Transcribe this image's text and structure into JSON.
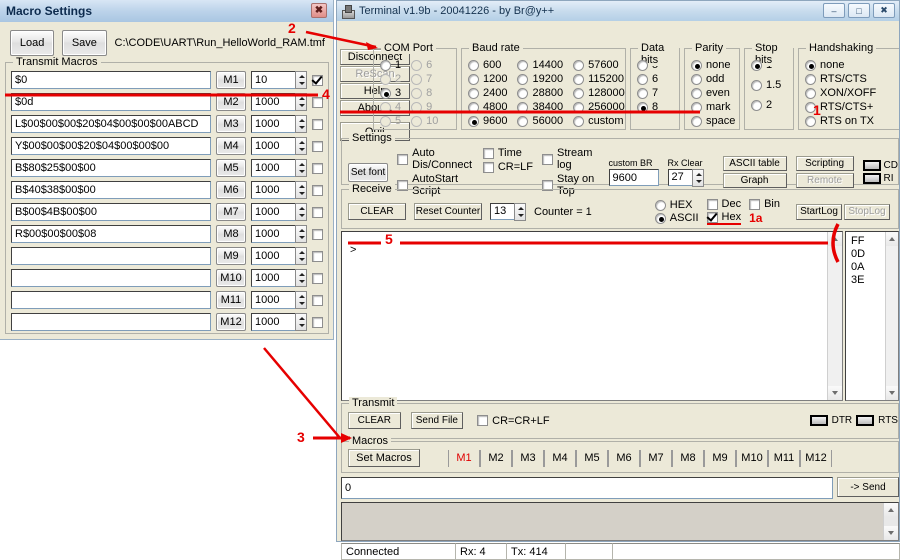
{
  "macro_window": {
    "title": "Macro Settings",
    "close_label": "✖",
    "load_label": "Load",
    "save_label": "Save",
    "file_path": "C:\\CODE\\UART\\Run_HelloWorld_RAM.tmf",
    "group_label": "Transmit Macros",
    "rows": [
      {
        "name": "M1",
        "text": "$0",
        "delay": "10",
        "checked": true
      },
      {
        "name": "M2",
        "text": "$0d",
        "delay": "1000",
        "checked": false
      },
      {
        "name": "M3",
        "text": "L$00$00$00$20$04$00$00$00ABCD",
        "delay": "1000",
        "checked": false
      },
      {
        "name": "M4",
        "text": "Y$00$00$00$20$04$00$00$00",
        "delay": "1000",
        "checked": false
      },
      {
        "name": "M5",
        "text": "B$80$25$00$00",
        "delay": "1000",
        "checked": false
      },
      {
        "name": "M6",
        "text": "B$40$38$00$00",
        "delay": "1000",
        "checked": false
      },
      {
        "name": "M7",
        "text": "B$00$4B$00$00",
        "delay": "1000",
        "checked": false
      },
      {
        "name": "M8",
        "text": "R$00$00$00$08",
        "delay": "1000",
        "checked": false
      },
      {
        "name": "M9",
        "text": "",
        "delay": "1000",
        "checked": false
      },
      {
        "name": "M10",
        "text": "",
        "delay": "1000",
        "checked": false
      },
      {
        "name": "M11",
        "text": "",
        "delay": "1000",
        "checked": false
      },
      {
        "name": "M12",
        "text": "",
        "delay": "1000",
        "checked": false
      }
    ]
  },
  "terminal": {
    "title": "Terminal v1.9b - 20041226 - by Br@y++",
    "titlebar_buttons": {
      "minimize": "–",
      "maximize": "□",
      "close": "✖"
    },
    "side_buttons": [
      {
        "label": "Disconnect",
        "enabled": true
      },
      {
        "label": "ReScan",
        "enabled": false
      },
      {
        "label": "Help",
        "enabled": true
      },
      {
        "label": "About..",
        "enabled": true
      },
      {
        "label": "Quit",
        "enabled": true
      }
    ],
    "com_port": {
      "label": "COM Port",
      "selected": "3",
      "col1": [
        {
          "v": "1",
          "enabled": true
        },
        {
          "v": "2",
          "enabled": false
        },
        {
          "v": "3",
          "enabled": true
        },
        {
          "v": "4",
          "enabled": false
        },
        {
          "v": "5",
          "enabled": false
        }
      ],
      "col2": [
        {
          "v": "6",
          "enabled": false
        },
        {
          "v": "7",
          "enabled": false
        },
        {
          "v": "8",
          "enabled": false
        },
        {
          "v": "9",
          "enabled": false
        },
        {
          "v": "10",
          "enabled": false
        }
      ]
    },
    "baud_rate": {
      "label": "Baud rate",
      "selected": "9600",
      "col1": [
        "600",
        "1200",
        "2400",
        "4800",
        "9600"
      ],
      "col2": [
        "14400",
        "19200",
        "28800",
        "38400",
        "56000"
      ],
      "col3": [
        "57600",
        "115200",
        "128000",
        "256000",
        "custom"
      ]
    },
    "data_bits": {
      "label": "Data bits",
      "selected": "8",
      "options": [
        "5",
        "6",
        "7",
        "8"
      ]
    },
    "parity": {
      "label": "Parity",
      "selected": "none",
      "options": [
        "none",
        "odd",
        "even",
        "mark",
        "space"
      ]
    },
    "stop_bits": {
      "label": "Stop bits",
      "selected": "1",
      "options": [
        "1",
        "1.5",
        "2"
      ]
    },
    "handshaking": {
      "label": "Handshaking",
      "selected": "none",
      "options": [
        "none",
        "RTS/CTS",
        "XON/XOFF",
        "RTS/CTS+",
        "RTS on TX"
      ]
    },
    "settings": {
      "label": "Settings",
      "set_font_label": "Set font",
      "checkboxes": [
        {
          "label": "Auto Dis/Connect",
          "checked": false
        },
        {
          "label": "AutoStart Script",
          "checked": false
        },
        {
          "label": "Time",
          "checked": false
        },
        {
          "label": "CR=LF",
          "checked": false
        },
        {
          "label": "Stream log",
          "checked": false
        },
        {
          "label": "Stay on Top",
          "checked": false
        }
      ],
      "custom_br_label": "custom BR",
      "custom_br_value": "9600",
      "rx_clear_label": "Rx Clear",
      "rx_clear_value": "27",
      "ascii_table_label": "ASCII table",
      "graph_label": "Graph",
      "scripting_label": "Scripting",
      "remote_label": "Remote",
      "cd_label": "CD",
      "ri_label": "RI"
    },
    "receive": {
      "label": "Receive",
      "clear_label": "CLEAR",
      "reset_counter_label": "Reset Counter",
      "counter_limit": "13",
      "counter_text": "Counter = 1",
      "mode_selected": "ASCII",
      "modes": [
        "HEX",
        "ASCII"
      ],
      "dec_label": "Dec",
      "dec_checked": false,
      "hex_label": "Hex",
      "hex_checked": true,
      "bin_label": "Bin",
      "bin_checked": false,
      "startlog_label": "StartLog",
      "stoplog_label": "StopLog",
      "text": ">",
      "hex_values": [
        "FF",
        "0D",
        "0A",
        "3E"
      ]
    },
    "transmit": {
      "label": "Transmit",
      "clear_label": "CLEAR",
      "send_file_label": "Send File",
      "crcrlf_label": "CR=CR+LF",
      "crcrlf_checked": false,
      "dtr_label": "DTR",
      "rts_label": "RTS"
    },
    "macros": {
      "label": "Macros",
      "set_macros_label": "Set Macros",
      "buttons": [
        "M1",
        "M2",
        "M3",
        "M4",
        "M5",
        "M6",
        "M7",
        "M8",
        "M9",
        "M10",
        "M11",
        "M12"
      ],
      "active": "M1"
    },
    "send": {
      "input_value": "0",
      "send_label": "-> Send"
    },
    "status": {
      "connection": "Connected",
      "rx": "Rx: 4",
      "tx": "Tx: 414"
    }
  },
  "annotations": {
    "one": "1",
    "one_a": "1a",
    "two": "2",
    "three": "3",
    "four": "4",
    "five": "5"
  },
  "colors": {
    "annotation": "#e60000",
    "active_macro": "#e00000",
    "title_gradient_start": "#d8e6f5"
  }
}
